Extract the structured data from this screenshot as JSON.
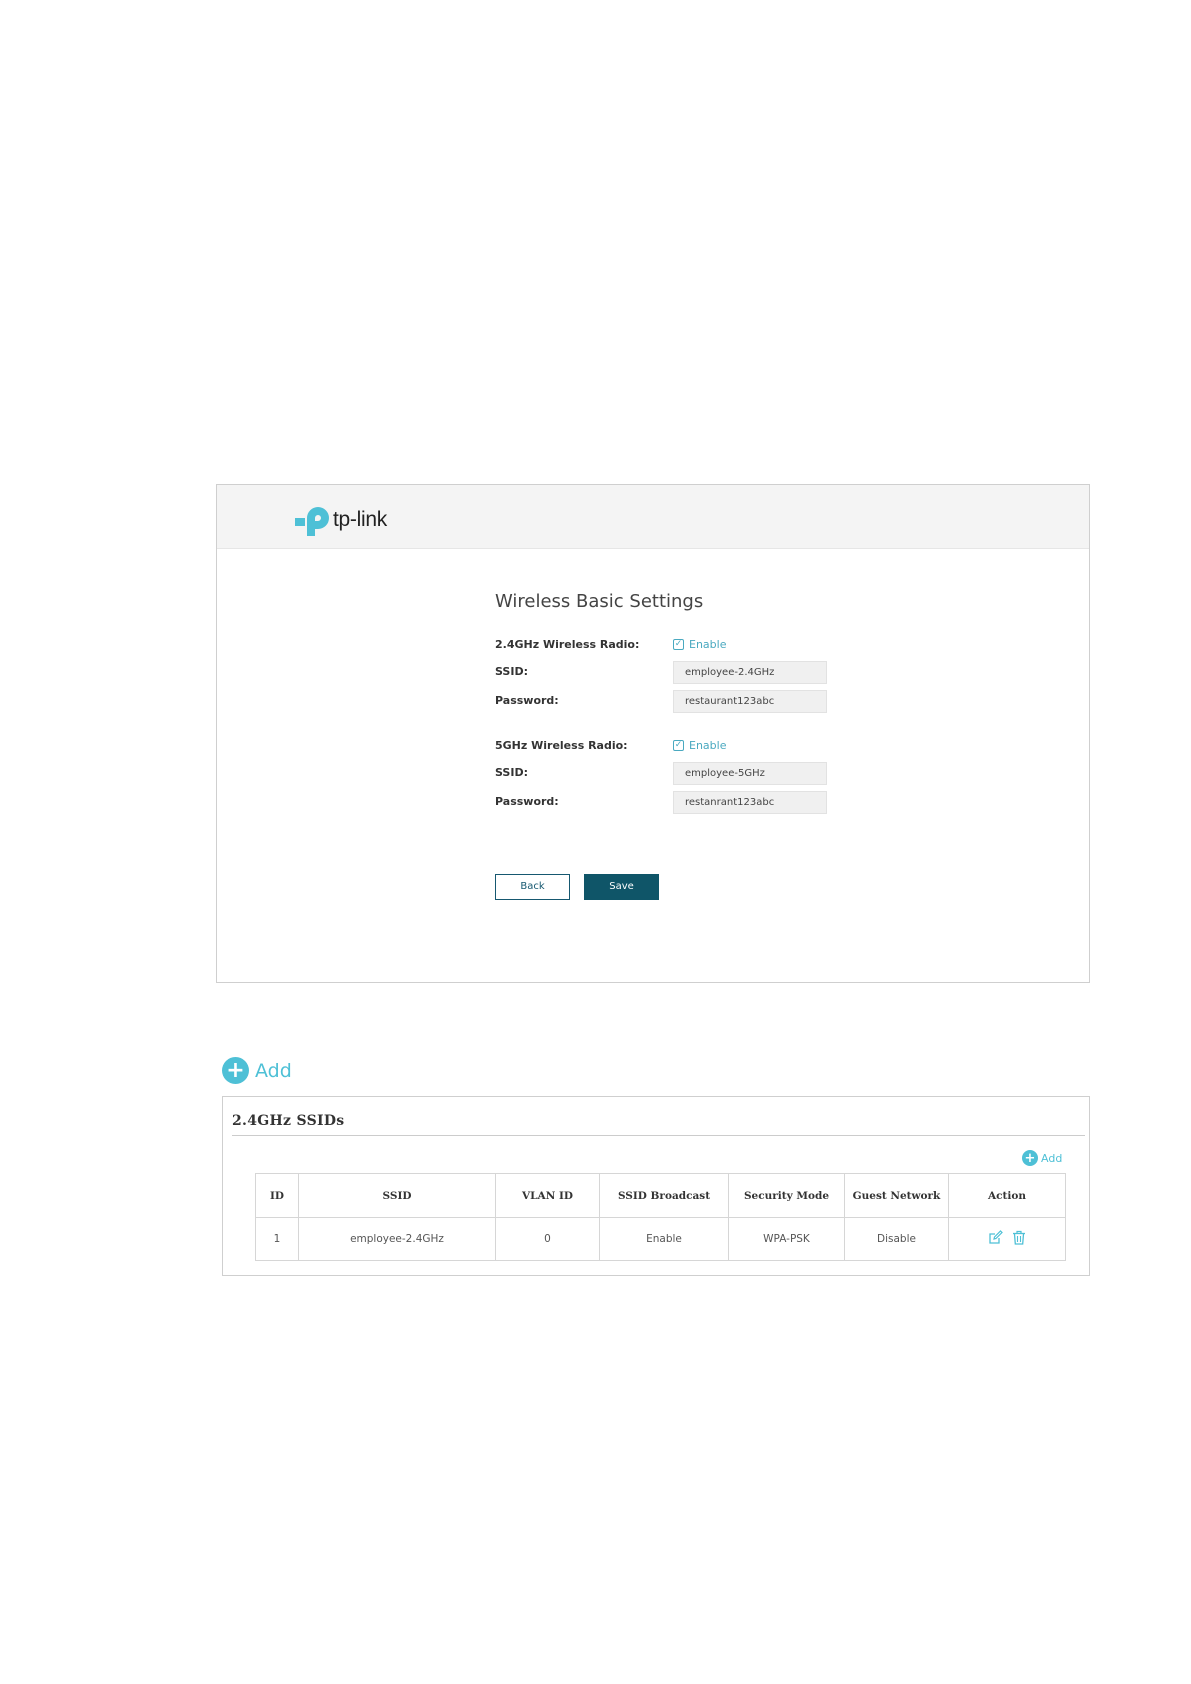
{
  "wireless_settings": {
    "brand": "tp-link",
    "title": "Wireless Basic Settings",
    "radio_24": {
      "label": "2.4GHz Wireless Radio:",
      "enable_label": "Enable",
      "enabled": true,
      "ssid_label": "SSID:",
      "ssid_value": "employee-2.4GHz",
      "password_label": "Password:",
      "password_value": "restaurant123abc"
    },
    "radio_5": {
      "label": "5GHz Wireless Radio:",
      "enable_label": "Enable",
      "enabled": true,
      "ssid_label": "SSID:",
      "ssid_value": "employee-5GHz",
      "password_label": "Password:",
      "password_value": "restanrant123abc"
    },
    "back_label": "Back",
    "save_label": "Save"
  },
  "add_link": {
    "label": "Add"
  },
  "ssid_panel": {
    "title": "2.4GHz SSIDs",
    "add_label": "Add",
    "columns": [
      "ID",
      "SSID",
      "VLAN ID",
      "SSID Broadcast",
      "Security Mode",
      "Guest Network",
      "Action"
    ],
    "rows": [
      {
        "id": "1",
        "ssid": "employee-2.4GHz",
        "vlan_id": "0",
        "broadcast": "Enable",
        "security": "WPA-PSK",
        "guest": "Disable",
        "actions": [
          "edit-icon",
          "delete-icon"
        ]
      }
    ]
  },
  "colors": {
    "accent": "#4ec0d6",
    "primary_button": "#0f5568",
    "header_bg": "#f4f4f4"
  }
}
